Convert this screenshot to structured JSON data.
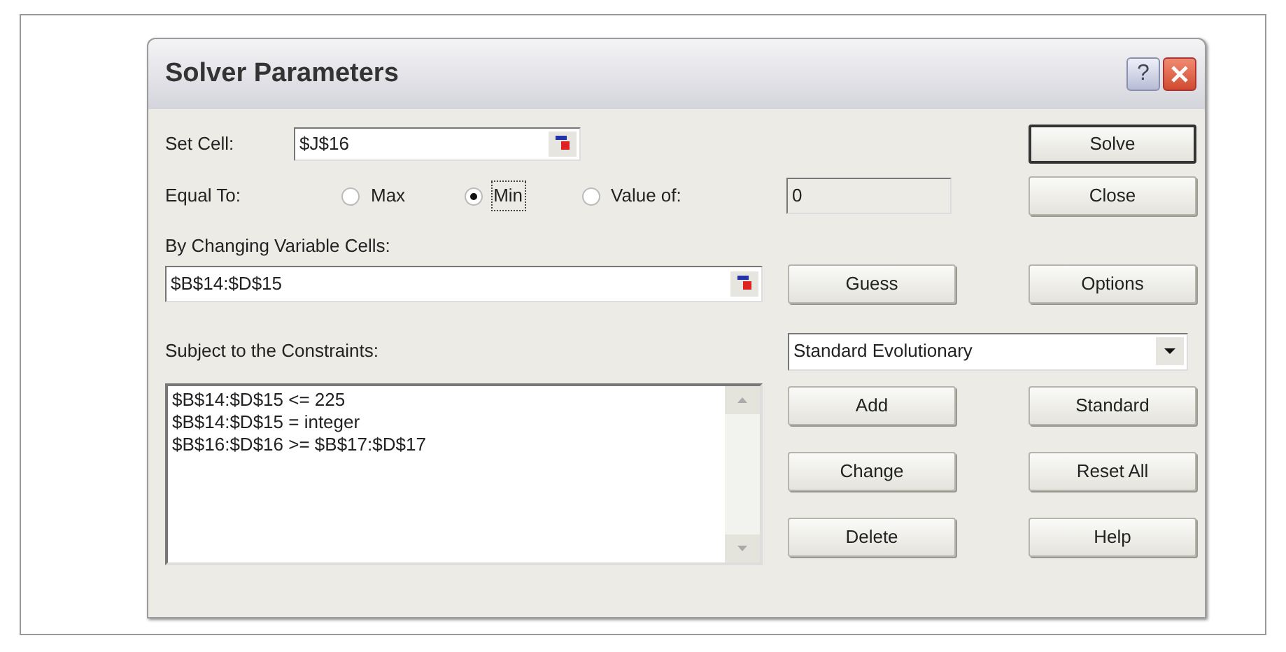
{
  "window": {
    "title": "Solver Parameters",
    "help": "?"
  },
  "set_cell": {
    "label": "Set Cell:",
    "value": "$J$16"
  },
  "equal_to": {
    "label": "Equal To:",
    "options": [
      {
        "label": "Max",
        "selected": false
      },
      {
        "label": "Min",
        "selected": true
      },
      {
        "label": "Value of:",
        "selected": false
      }
    ],
    "value": "0"
  },
  "changing_cells": {
    "label": "By Changing Variable Cells:",
    "value": "$B$14:$D$15"
  },
  "constraints": {
    "label": "Subject to the Constraints:",
    "items": [
      "$B$14:$D$15 <= 225",
      "$B$14:$D$15 = integer",
      "$B$16:$D$16 >= $B$17:$D$17"
    ]
  },
  "engine": {
    "value": "Standard Evolutionary"
  },
  "top_buttons": [
    "Solve",
    "Close",
    "Guess",
    "Options"
  ],
  "list_buttons": [
    "Add",
    "Change",
    "Delete"
  ],
  "side_buttons": [
    "Standard",
    "Reset All",
    "Help"
  ]
}
